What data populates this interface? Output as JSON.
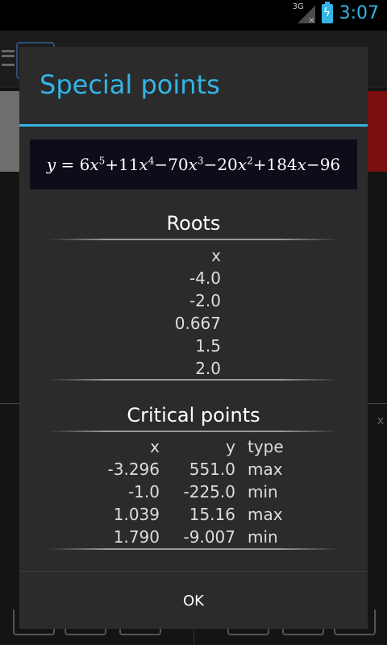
{
  "status_bar": {
    "network_label": "3G",
    "network_x": "×",
    "time": "3:07",
    "battery_icon": "battery-charging-icon",
    "accent": "#33b5e5"
  },
  "background": {
    "axis_label": "x"
  },
  "dialog": {
    "title": "Special points",
    "formula": {
      "lhs": "y",
      "equals": " = ",
      "terms": [
        {
          "coef": "6",
          "var": "x",
          "exp": "5",
          "op": ""
        },
        {
          "coef": "11",
          "var": "x",
          "exp": "4",
          "op": "+"
        },
        {
          "coef": "70",
          "var": "x",
          "exp": "3",
          "op": "−"
        },
        {
          "coef": "20",
          "var": "x",
          "exp": "2",
          "op": "−"
        },
        {
          "coef": "184",
          "var": "x",
          "exp": "",
          "op": "+"
        },
        {
          "coef": "96",
          "var": "",
          "exp": "",
          "op": "−"
        }
      ]
    },
    "roots": {
      "heading": "Roots",
      "column_header": "x",
      "values": [
        "-4.0",
        "-2.0",
        "0.667",
        "1.5",
        "2.0"
      ]
    },
    "critical_points": {
      "heading": "Critical points",
      "headers": {
        "x": "x",
        "y": "y",
        "type": "type"
      },
      "rows": [
        {
          "x": "-3.296",
          "y": "551.0",
          "type": "max"
        },
        {
          "x": "-1.0",
          "y": "-225.0",
          "type": "min"
        },
        {
          "x": "1.039",
          "y": "15.16",
          "type": "max"
        },
        {
          "x": "1.790",
          "y": "-9.007",
          "type": "min"
        }
      ]
    },
    "ok_label": "OK"
  }
}
